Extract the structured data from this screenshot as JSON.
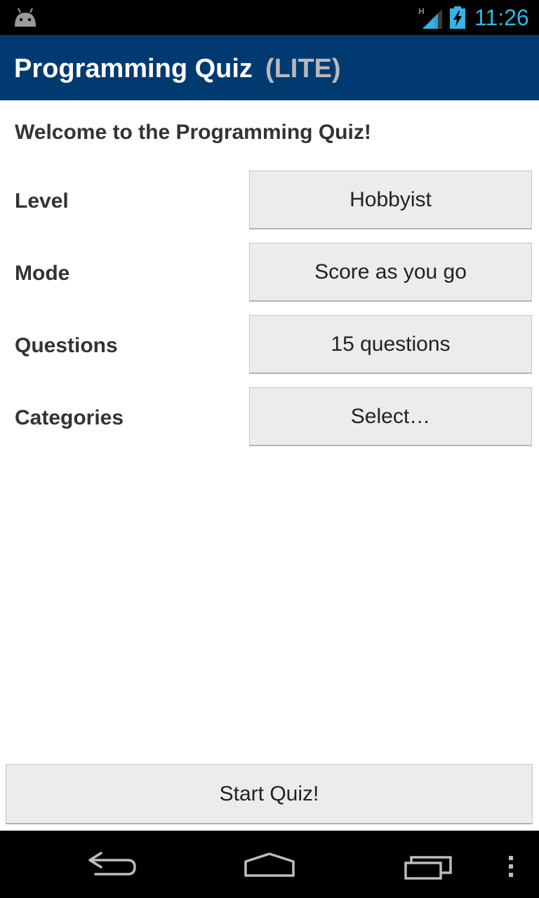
{
  "status_bar": {
    "time": "11:26",
    "network_type": "H",
    "icons": [
      "android-icon",
      "signal-icon",
      "battery-charging-icon"
    ]
  },
  "action_bar": {
    "title": "Programming Quiz",
    "badge": "(LITE)"
  },
  "main": {
    "welcome": "Welcome to the Programming Quiz!",
    "settings": [
      {
        "label": "Level",
        "value": "Hobbyist"
      },
      {
        "label": "Mode",
        "value": "Score as you go"
      },
      {
        "label": "Questions",
        "value": "15 questions"
      },
      {
        "label": "Categories",
        "value": "Select…"
      }
    ],
    "start_button": "Start Quiz!"
  },
  "nav_bar": {
    "icons": [
      "back-icon",
      "home-icon",
      "recent-apps-icon",
      "menu-icon"
    ]
  },
  "colors": {
    "action_bar": "#003a70",
    "clock": "#33b5e5",
    "button_bg": "#ececec"
  }
}
